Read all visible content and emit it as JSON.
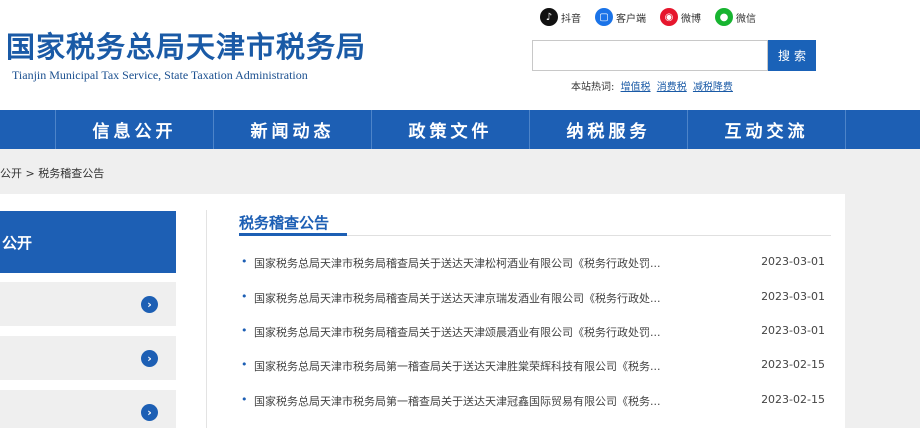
{
  "header": {
    "title_cn": "国家税务总局天津市税务局",
    "title_en": "Tianjin Municipal Tax Service, State Taxation Administration"
  },
  "social": [
    {
      "label": "抖音",
      "icon": "douyin-icon"
    },
    {
      "label": "客户端",
      "icon": "client-app-icon"
    },
    {
      "label": "微博",
      "icon": "weibo-icon"
    },
    {
      "label": "微信",
      "icon": "wechat-icon"
    }
  ],
  "search": {
    "placeholder": "",
    "button_label": "搜索"
  },
  "hotwords": {
    "label": "本站热词:",
    "items": [
      "增值税",
      "消费税",
      "减税降费"
    ]
  },
  "nav": {
    "items": [
      "信息公开",
      "新闻动态",
      "政策文件",
      "纳税服务",
      "互动交流"
    ]
  },
  "breadcrumb": {
    "text": "公开 > 税务稽查公告"
  },
  "sidebar": {
    "active_label": "公开"
  },
  "main": {
    "section_title": "税务稽查公告",
    "rows": [
      {
        "title": "国家税务总局天津市税务局稽查局关于送达天津松柯酒业有限公司《税务行政处罚...",
        "date": "2023-03-01"
      },
      {
        "title": "国家税务总局天津市税务局稽查局关于送达天津京瑞发酒业有限公司《税务行政处...",
        "date": "2023-03-01"
      },
      {
        "title": "国家税务总局天津市税务局稽查局关于送达天津颂晨酒业有限公司《税务行政处罚...",
        "date": "2023-03-01"
      },
      {
        "title": "国家税务总局天津市税务局第一稽查局关于送达天津胜棠荣辉科技有限公司《税务...",
        "date": "2023-02-15"
      },
      {
        "title": "国家税务总局天津市税务局第一稽查局关于送达天津冠鑫国际贸易有限公司《税务...",
        "date": "2023-02-15"
      }
    ]
  },
  "colors": {
    "brand": "#1d5fb4",
    "gray_band": "#efefef"
  }
}
